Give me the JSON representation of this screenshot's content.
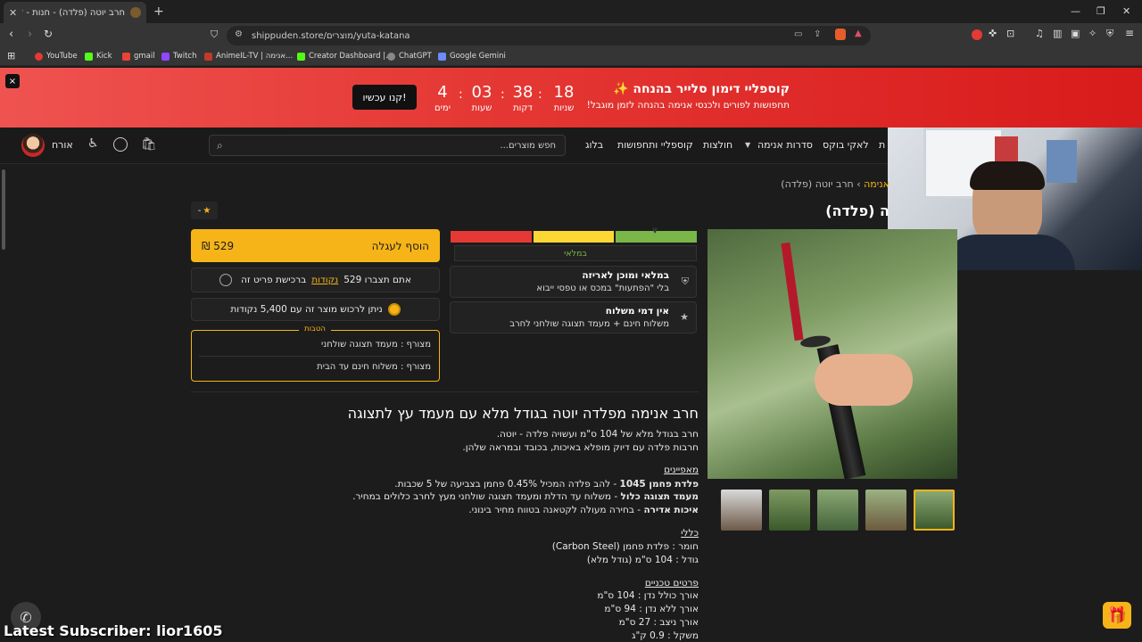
{
  "browser": {
    "tab_title": "חרב יוטה (פלדה) - חנות - דוכן שי",
    "url": "shippuden.store/מוצרים/yuta-katana",
    "bookmarks": [
      "YouTube",
      "Kick",
      "gmail",
      "Twitch",
      "AnimeIL-TV | אנימה...",
      "Creator Dashboard |...",
      "ChatGPT",
      "Google Gemini"
    ]
  },
  "promo": {
    "title": "קוספליי דימון סלייר בהנחה ✨",
    "subtitle": "תחפושות לפורים ולכנסי אנימה בהנחה לזמן מוגבל!",
    "countdown": [
      {
        "value": "18",
        "label": "שניות"
      },
      {
        "value": "38",
        "label": "דקות"
      },
      {
        "value": "03",
        "label": "שעות"
      },
      {
        "value": "4",
        "label": "ימים"
      }
    ],
    "cta": "קנו עכשיו!",
    "close": "×"
  },
  "header": {
    "nav": [
      "לאקי בוקס",
      "סדרות אנימה",
      "חולצות",
      "קוספליי ותחפושות",
      "בלוג"
    ],
    "nav_partial": "ת",
    "search_placeholder": "חפש מוצרים...",
    "user": "אורח"
  },
  "product": {
    "breadcrumb_sep": "›",
    "breadcrumb_cat": "אנימה",
    "breadcrumb_current": "חרב יוטה (פלדה)",
    "title": "ה (פלדה)",
    "rating": "-",
    "add_to_cart": "הוסף לעגלה",
    "price": "529 ₪",
    "points_earn_pre": "אתם תצברו 529",
    "points_earn_link": "נקודות",
    "points_earn_post": "ברכישת פריט זה",
    "points_redeem": "ניתן לרכוש מוצר זה עם 5,400 נקודות",
    "benefits_tag": "הטבות",
    "benefits": [
      "מצורף : מעמד תצוגה שולחני",
      "מצורף : משלוח חינם עד הבית"
    ],
    "stock_label": "במלאי",
    "features": [
      {
        "title": "במלאי ומוכן לאריזה",
        "desc": "בלי \"הפתעות\" במכס או טפסי ייבוא"
      },
      {
        "title": "אין דמי משלוח",
        "desc": "משלוח חינם + מעמד תצוגה שולחני לחרב"
      }
    ],
    "colors": {
      "accent": "#f6b418",
      "promo": "#e53935",
      "stock_red": "#e53935",
      "stock_yellow": "#fdd835",
      "stock_green": "#7ab648"
    }
  },
  "description": {
    "heading": "חרב אנימה מפלדה יוטה בגודל מלא עם מעמד עץ לתצוגה",
    "intro": [
      "חרב בגודל מלא של 104 ס\"מ ועשויה פלדה - יוטה.",
      "חרבות פלדה עם דיוק מופלא באיכות, בכובד ובמראה שלהן."
    ],
    "features_title": "מאפיינים",
    "features": [
      {
        "bold": "פלדת פחמן 1045",
        "text": " - להב פלדה המכיל 0.45% פחמן בצביעה של 5 שכבות."
      },
      {
        "bold": "מעמד תצוגה כלול",
        "text": " - משלוח עד הדלת ומעמד תצוגה שולחני מעץ לחרב כלולים במחיר."
      },
      {
        "bold": "איכות אדירה",
        "text": " - בחירה מעולה לקטאנה בטווח מחיר בינוני."
      }
    ],
    "general_title": "כללי",
    "general": [
      "חומר : פלדת פחמן (Carbon Steel)",
      "גודל : 104 ס\"מ (גודל מלא)"
    ],
    "tech_title": "פרטים טכניים",
    "tech": [
      "אורך כולל נדן : 104 ס\"מ",
      "אורך ללא נדן : 94 ס\"מ",
      "אורך ניצב : 27 ס\"מ",
      "משקל : 0.9 ק\"ג"
    ]
  },
  "overlay": {
    "subscriber": "Latest Subscriber: lior1605"
  }
}
